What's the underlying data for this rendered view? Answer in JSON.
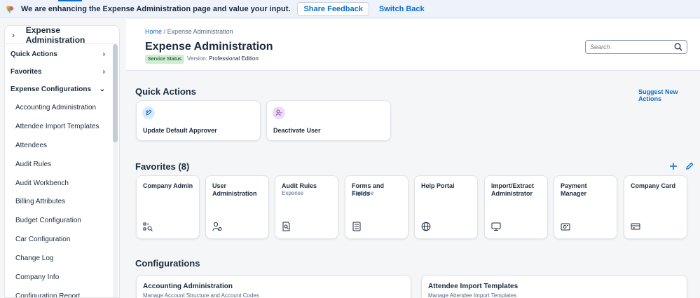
{
  "banner": {
    "message": "We are enhancing the Expense Administration page and value your input.",
    "feedback_label": "Share Feedback",
    "switch_label": "Switch Back"
  },
  "sidebar": {
    "title": "Expense Administration",
    "sections": [
      {
        "label": "Quick Actions",
        "state": "collapsed"
      },
      {
        "label": "Favorites",
        "state": "collapsed"
      },
      {
        "label": "Expense Configurations",
        "state": "expanded"
      }
    ],
    "items": [
      "Accounting Administration",
      "Attendee Import Templates",
      "Attendees",
      "Audit Rules",
      "Audit Workbench",
      "Billing Attributes",
      "Budget Configuration",
      "Car Configuration",
      "Change Log",
      "Company Info",
      "Configuration Report"
    ]
  },
  "header": {
    "breadcrumb_home": "Home",
    "breadcrumb_sep": "/",
    "breadcrumb_current": "Expense Administration",
    "title": "Expense Administration",
    "status_badge": "Service Status",
    "version_label": "Version:",
    "version_value": "Professional Edition",
    "search_placeholder": "Search"
  },
  "quick_actions": {
    "title": "Quick Actions",
    "suggest_link": "Suggest New Actions",
    "cards": [
      {
        "label": "Update Default Approver",
        "icon": "approver-edit-icon",
        "icon_bg": "#dbeafc"
      },
      {
        "label": "Deactivate User",
        "icon": "user-remove-icon",
        "icon_bg": "#ecdcf5"
      }
    ]
  },
  "favorites": {
    "title": "Favorites (8)",
    "cards": [
      {
        "title": "Company Admin",
        "subtitle": "",
        "icon": "company-admin-icon"
      },
      {
        "title": "User Administration",
        "subtitle": "",
        "icon": "user-settings-icon"
      },
      {
        "title": "Audit Rules",
        "subtitle": "Expense",
        "icon": "audit-document-icon"
      },
      {
        "title": "Forms and Fields",
        "subtitle": "Expense",
        "icon": "form-icon"
      },
      {
        "title": "Help Portal",
        "subtitle": "",
        "icon": "globe-icon"
      },
      {
        "title": "Import/Extract Administrator",
        "subtitle": "",
        "icon": "monitor-icon"
      },
      {
        "title": "Payment Manager",
        "subtitle": "",
        "icon": "payment-icon"
      },
      {
        "title": "Company Card",
        "subtitle": "",
        "icon": "card-icon"
      }
    ]
  },
  "configurations": {
    "title": "Configurations",
    "cards": [
      {
        "title": "Accounting Administration",
        "subtitle": "Manage Account Structure and Account Codes"
      },
      {
        "title": "Attendee Import Templates",
        "subtitle": "Manage Attendee Import Templates"
      }
    ]
  },
  "colors": {
    "accent": "#0a6ed1",
    "status_green_bg": "#d4ecd5",
    "status_green_text": "#256f3a"
  }
}
